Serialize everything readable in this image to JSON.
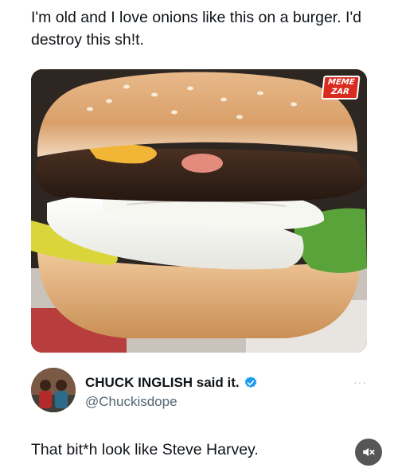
{
  "post": {
    "caption": "I'm old and I love onions like this on a burger. I'd destroy this sh!t.",
    "watermark_line1": "MEME",
    "watermark_line2": "ZAR"
  },
  "quoted": {
    "display_name": "CHUCK INGLISH said it.",
    "handle": "@Chuckisdope",
    "more_label": "···",
    "text": "That bit*h look like Steve Harvey."
  },
  "icons": {
    "verified": "verified-badge-icon",
    "mute": "speaker-muted-icon",
    "more": "more-dots-icon"
  },
  "colors": {
    "verified_blue": "#1d9bf0",
    "handle_gray": "#536471",
    "mute_button": "#565656"
  }
}
